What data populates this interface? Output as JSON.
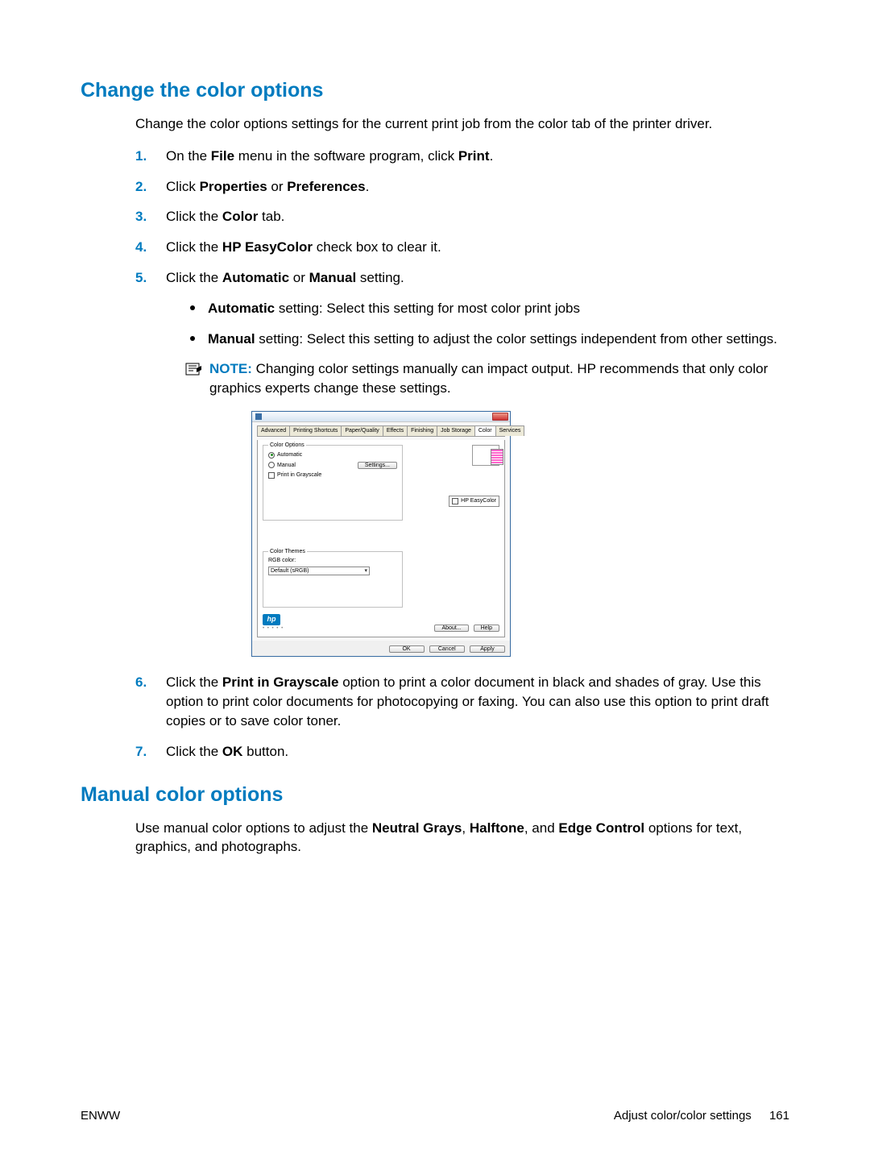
{
  "heading1": "Change the color options",
  "intro": "Change the color options settings for the current print job from the color tab of the printer driver.",
  "steps": {
    "s1_a": "On the ",
    "s1_file": "File",
    "s1_b": " menu in the software program, click ",
    "s1_print": "Print",
    "s1_c": ".",
    "s2_a": "Click ",
    "s2_prop": "Properties",
    "s2_b": " or ",
    "s2_pref": "Preferences",
    "s2_c": ".",
    "s3_a": "Click the ",
    "s3_color": "Color",
    "s3_b": " tab.",
    "s4_a": "Click the ",
    "s4_hp": "HP EasyColor",
    "s4_b": " check box to clear it.",
    "s5_a": "Click the ",
    "s5_auto": "Automatic",
    "s5_b": " or ",
    "s5_manual": "Manual",
    "s5_c": " setting.",
    "bul1_a": "Automatic",
    "bul1_b": " setting: Select this setting for most color print jobs",
    "bul2_a": "Manual",
    "bul2_b": " setting: Select this setting to adjust the color settings independent from other settings.",
    "note_label": "NOTE:",
    "note_body": "Changing color settings manually can impact output. HP recommends that only color graphics experts change these settings.",
    "s6_a": "Click the ",
    "s6_pig": "Print in Grayscale",
    "s6_b": " option to print a color document in black and shades of gray. Use this option to print color documents for photocopying or faxing. You can also use this option to print draft copies or to save color toner.",
    "s7_a": "Click the ",
    "s7_ok": "OK",
    "s7_b": " button."
  },
  "heading2": "Manual color options",
  "para2_a": "Use manual color options to adjust the ",
  "para2_ng": "Neutral Grays",
  "para2_b": ", ",
  "para2_ht": "Halftone",
  "para2_c": ", and ",
  "para2_ec": "Edge Control",
  "para2_d": " options for text, graphics, and photographs.",
  "dialog": {
    "tabs": [
      "Advanced",
      "Printing Shortcuts",
      "Paper/Quality",
      "Effects",
      "Finishing",
      "Job Storage",
      "Color",
      "Services"
    ],
    "grp_color_options": "Color Options",
    "radio_auto": "Automatic",
    "radio_manual": "Manual",
    "btn_settings": "Settings...",
    "chk_grayscale": "Print in Grayscale",
    "chk_easycolor": "HP EasyColor",
    "grp_themes": "Color Themes",
    "lbl_rgb": "RGB color:",
    "dd_default": "Default (sRGB)",
    "logo": "hp",
    "btn_about": "About...",
    "btn_help": "Help",
    "btn_ok": "OK",
    "btn_cancel": "Cancel",
    "btn_apply": "Apply"
  },
  "footer": {
    "left": "ENWW",
    "right_text": "Adjust color/color settings",
    "page_num": "161"
  }
}
